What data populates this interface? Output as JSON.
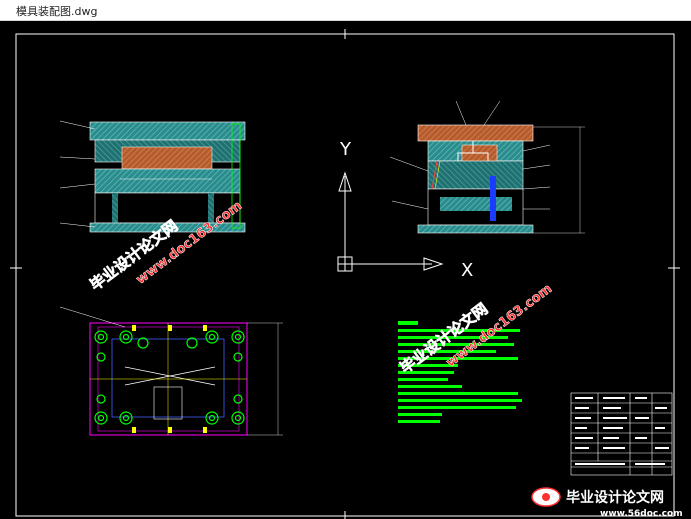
{
  "window": {
    "title": "模具装配图.dwg"
  },
  "axes": {
    "y_label": "Y",
    "x_label": "X"
  },
  "watermarks": {
    "site_cn": "毕业设计论文网",
    "site_url": "www.doc163.com",
    "footer_cn": "毕业设计论文网",
    "footer_url": "www.56doc.com"
  },
  "colors": {
    "canvas_bg": "#000000",
    "frame": "#ffffff",
    "mold_plate": "#2a8c8c",
    "mold_hatch": "#5fb0b0",
    "hot_plate": "#c0683a",
    "outline": "#ff00ff",
    "green_line": "#00ff00",
    "yellow_line": "#ffff00",
    "blue_line": "#4060ff",
    "watermark": "#ff3030"
  },
  "icons": {
    "ucs": "ucs-icon",
    "logo": "site-logo-icon"
  }
}
